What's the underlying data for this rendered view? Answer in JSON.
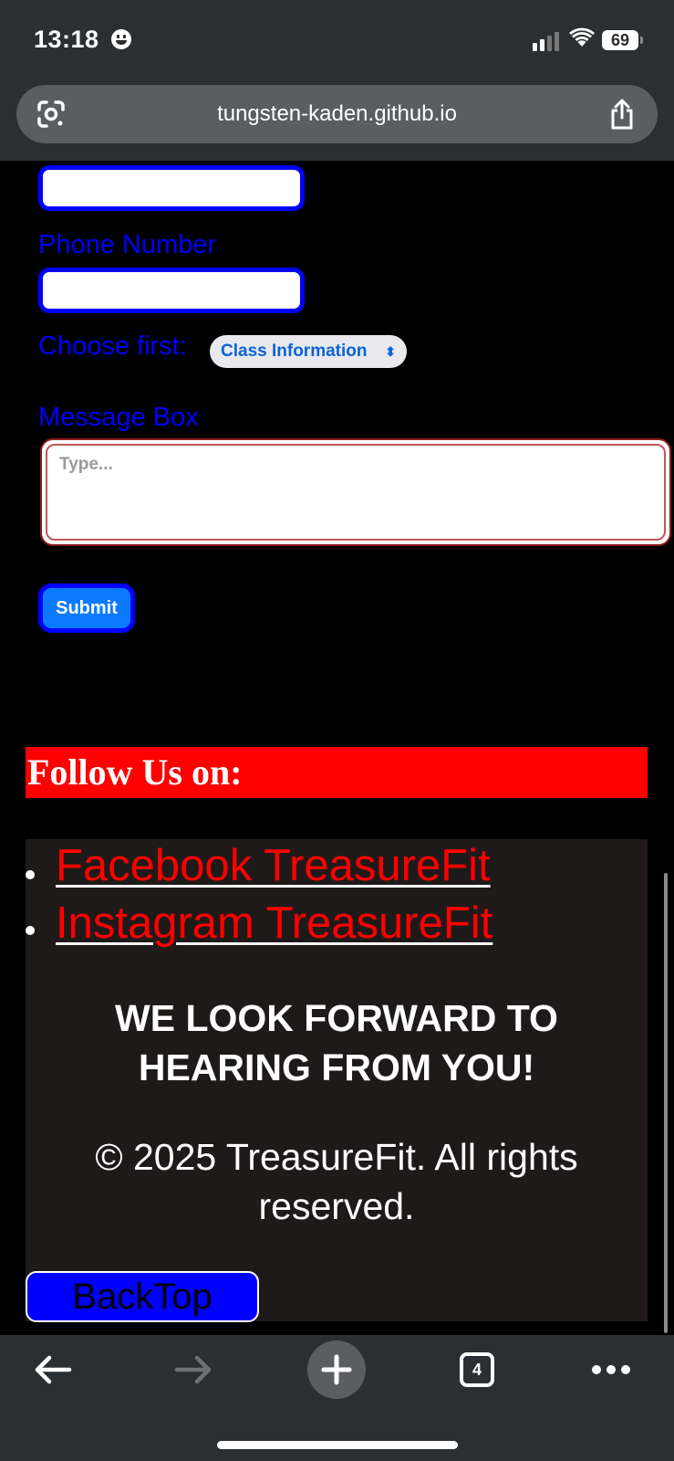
{
  "status_bar": {
    "time": "13:18",
    "battery": "69"
  },
  "browser": {
    "url": "tungsten-kaden.github.io"
  },
  "form": {
    "phone_label": "Phone Number",
    "choose_label": "Choose first:",
    "select_value": "Class Information",
    "message_label": "Message Box",
    "message_placeholder": "Type...",
    "submit_label": "Submit"
  },
  "footer": {
    "follow_heading": "Follow Us on:",
    "links": [
      {
        "label": "Facebook TreasureFit"
      },
      {
        "label": "Instagram TreasureFit"
      }
    ],
    "tagline_line1": "WE LOOK FORWARD TO",
    "tagline_line2": "HEARING FROM YOU!",
    "copyright_line1": "© 2025 TreasureFit. All rights",
    "copyright_line2": "reserved.",
    "back_top_label": "BackTop"
  },
  "toolbar": {
    "tab_count": "4"
  },
  "colors": {
    "form_accent": "#0000ff",
    "link_color": "#ff0000",
    "heading_bg": "#ff0000",
    "footer_bg": "#1f1a1a",
    "chrome_bg": "#2c2f31"
  }
}
